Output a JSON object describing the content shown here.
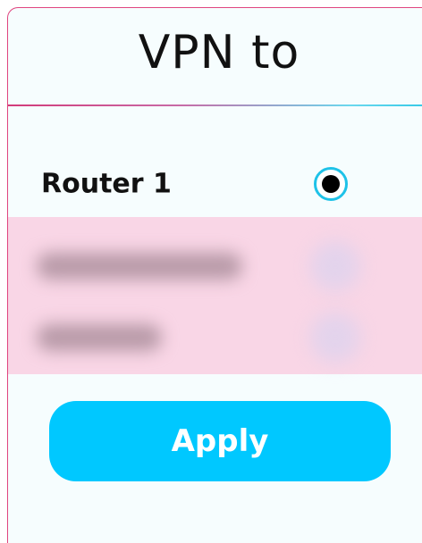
{
  "dialog": {
    "title": "VPN to"
  },
  "options": [
    {
      "label": "Router 1",
      "selected": true
    }
  ],
  "actions": {
    "apply_label": "Apply"
  },
  "colors": {
    "accent": "#00c8ff",
    "radio_border": "#1ec2e8",
    "border_pink": "#e0457f",
    "redacted_bg": "#f9d6e6"
  }
}
